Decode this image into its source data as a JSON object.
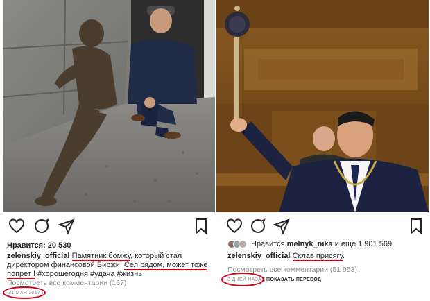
{
  "left_post": {
    "likes_label": "Нравится: 20 530",
    "username": "zelenskiy_official",
    "caption_hl1": "Памятник бомжу",
    "caption_mid": ", который стал директором финансовой Биржи. ",
    "caption_hl2": "Сел рядом, может тоже попрет !",
    "caption_tags": " #хорошегодня #удача #жизнь",
    "comments_link": "Посмотреть все комментарии (167)",
    "date": "31 МАЯ 2017 Г."
  },
  "right_post": {
    "likes_prefix": "Нравится",
    "likes_user": "melnyk_nika",
    "likes_suffix": "и еще 1 901 569",
    "username": "zelenskiy_official",
    "caption_hl": "Склав присягу",
    "caption_end": ".",
    "comments_link": "Посмотреть все комментарии (51 953)",
    "date": "3 ДНЕЙ НАЗАД",
    "translate_label": "ПОКАЗАТЬ ПЕРЕВОД"
  },
  "icons": [
    "heart-icon",
    "comment-icon",
    "share-icon",
    "bookmark-icon"
  ],
  "colors": {
    "highlight": "#d0021b",
    "muted": "#8e8e8e",
    "text": "#262626"
  }
}
